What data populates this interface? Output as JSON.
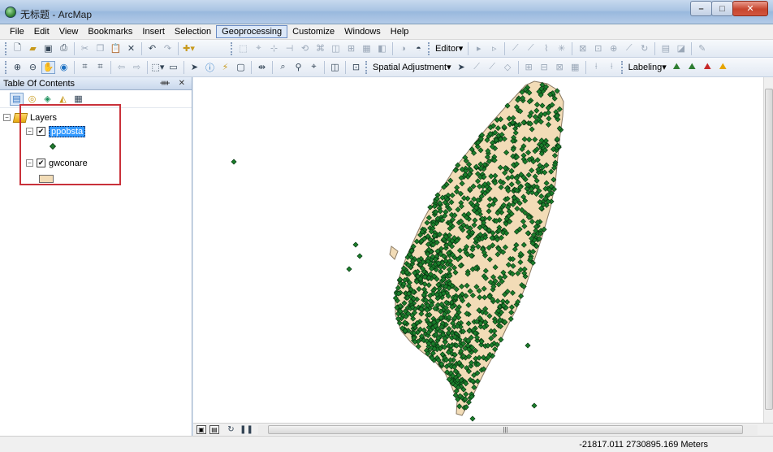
{
  "window": {
    "title": "无标题 - ArcMap",
    "minimize": "–",
    "maximize": "□",
    "close": "✕"
  },
  "menu": [
    "File",
    "Edit",
    "View",
    "Bookmarks",
    "Insert",
    "Selection",
    "Geoprocessing",
    "Customize",
    "Windows",
    "Help"
  ],
  "toolbar": {
    "editor_label": "Editor▾",
    "spatial_adjustment_label": "Spatial Adjustment▾",
    "labeling_label": "Labeling▾"
  },
  "toc": {
    "title": "Table Of Contents",
    "pin": "ᚓ ✕",
    "root_label": "Layers",
    "layers": [
      {
        "name": "ppobsta",
        "checked": true,
        "selected": true,
        "symbol": "point",
        "symbol_color": "#1f7a2e"
      },
      {
        "name": "gwconare",
        "checked": true,
        "selected": false,
        "symbol": "polygon",
        "symbol_color": "#f2dcb7"
      }
    ]
  },
  "map": {
    "point_color": "#1a7d2a",
    "polygon_color": "#f2dcb7",
    "point_count_visible": 1200
  },
  "scrollbar": {
    "grip": "|||"
  },
  "status": {
    "coordinates": "-21817.011  2730895.169 Meters"
  }
}
